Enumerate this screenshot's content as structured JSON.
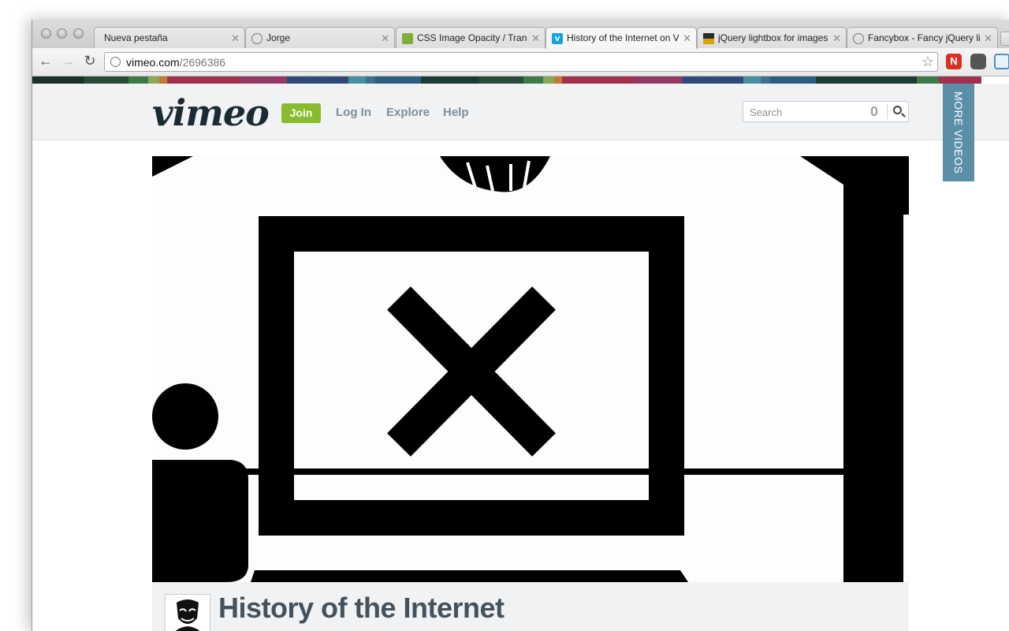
{
  "browser": {
    "tabs": [
      {
        "title": "Nueva pestaña",
        "favicon": "none"
      },
      {
        "title": "Jorge",
        "favicon": "globe-icon"
      },
      {
        "title": "CSS Image Opacity / Transparency",
        "favicon": "w3schools-icon"
      },
      {
        "title": "History of the Internet on Vimeo",
        "favicon": "vimeo-icon",
        "active": true
      },
      {
        "title": "jQuery lightbox for images",
        "favicon": "jquery-icon"
      },
      {
        "title": "Fancybox - Fancy jQuery lightbox",
        "favicon": "globe-icon"
      }
    ],
    "url_host": "vimeo.com",
    "url_path": "/2696386"
  },
  "header": {
    "logo": "vimeo",
    "join": "Join",
    "nav": [
      "Log In",
      "Explore",
      "Help"
    ],
    "search_placeholder": "Search"
  },
  "more_videos": "MORE VIDEOS",
  "video": {
    "title": "History of the Internet"
  },
  "colors": {
    "join_bg": "#88bb2e",
    "more_videos_bg": "#5b8fa8",
    "title": "#43525c",
    "nav_link": "#7d8f9a"
  }
}
